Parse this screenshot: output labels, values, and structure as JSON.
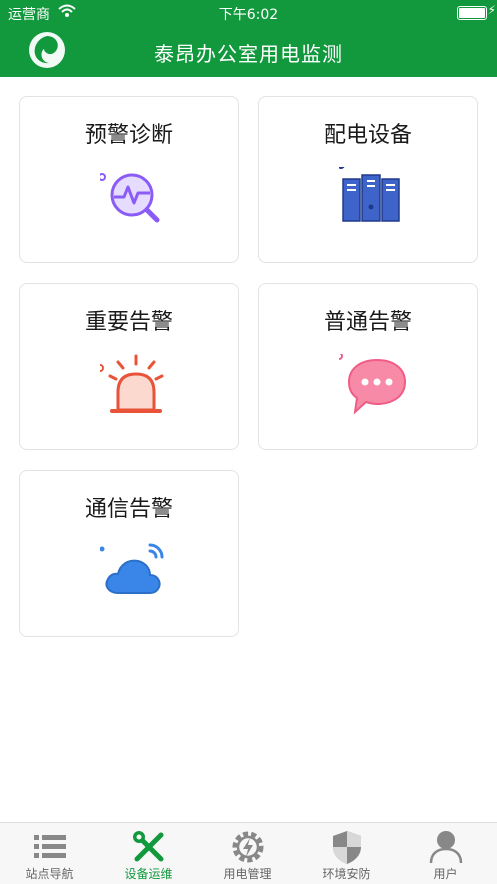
{
  "status": {
    "carrier": "运营商",
    "time": "下午6:02"
  },
  "header": {
    "title": "泰昂办公室用电监测"
  },
  "cards": [
    {
      "label": "预警诊断",
      "icon": "search-pulse-icon"
    },
    {
      "label": "配电设备",
      "icon": "server-rack-icon"
    },
    {
      "label": "重要告警",
      "icon": "alarm-light-icon"
    },
    {
      "label": "普通告警",
      "icon": "chat-bubble-icon"
    },
    {
      "label": "通信告警",
      "icon": "cloud-signal-icon"
    }
  ],
  "tabs": [
    {
      "label": "站点导航",
      "icon": "list-icon",
      "active": false
    },
    {
      "label": "设备运维",
      "icon": "tools-icon",
      "active": true
    },
    {
      "label": "用电管理",
      "icon": "gear-bolt-icon",
      "active": false
    },
    {
      "label": "环境安防",
      "icon": "shield-icon",
      "active": false
    },
    {
      "label": "用户",
      "icon": "user-icon",
      "active": false
    }
  ],
  "colors": {
    "brand": "#12993d",
    "purple": "#8a5cf5",
    "blue": "#3f64c9",
    "red": "#e8533a",
    "pink": "#ef5d87",
    "sky": "#3a86e8"
  }
}
